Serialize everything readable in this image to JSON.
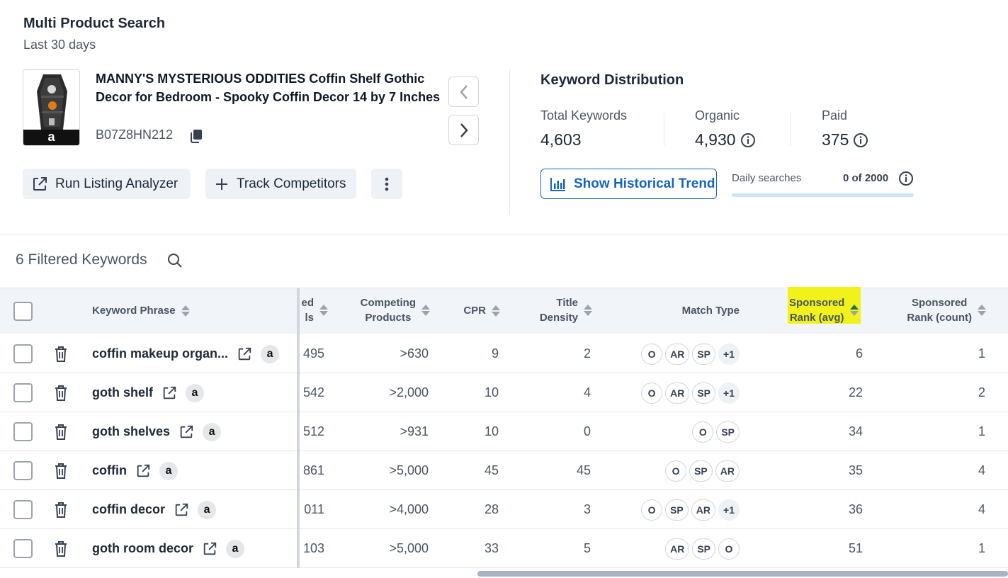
{
  "header": {
    "title": "Multi Product Search",
    "subtitle": "Last 30 days"
  },
  "product": {
    "title": "MANNY'S MYSTERIOUS ODDITIES Coffin Shelf Gothic Decor for Bedroom - Spooky Coffin Decor 14 by 7 Inches",
    "asin": "B07Z8HN212",
    "image_badge": "a"
  },
  "actions": {
    "run_listing": "Run Listing Analyzer",
    "track_competitors": "Track Competitors"
  },
  "distribution": {
    "title": "Keyword Distribution",
    "total_label": "Total Keywords",
    "total_value": "4,603",
    "organic_label": "Organic",
    "organic_value": "4,930",
    "paid_label": "Paid",
    "paid_value": "375",
    "show_trend": "Show Historical Trend",
    "daily_label": "Daily searches",
    "daily_count": "0 of 2000",
    "daily_progress": 0
  },
  "filter": {
    "label": "6 Filtered Keywords"
  },
  "table": {
    "headers": {
      "keyword": "Keyword Phrase",
      "searches_1": "ed",
      "searches_2": "ls",
      "competing_1": "Competing",
      "competing_2": "Products",
      "cpr": "CPR",
      "title_1": "Title",
      "title_2": "Density",
      "match": "Match Type",
      "sp_avg_1": "Sponsored",
      "sp_avg_2": "Rank (avg)",
      "sp_cnt_1": "Sponsored",
      "sp_cnt_2": "Rank (count)"
    },
    "rows": [
      {
        "keyword": "coffin makeup organ...",
        "searches": "495",
        "competing": ">630",
        "cpr": "9",
        "title_density": "2",
        "match": [
          "O",
          "AR",
          "SP",
          "+1"
        ],
        "sp_avg": "6",
        "sp_count": "1"
      },
      {
        "keyword": "goth shelf",
        "searches": "542",
        "competing": ">2,000",
        "cpr": "10",
        "title_density": "4",
        "match": [
          "O",
          "AR",
          "SP",
          "+1"
        ],
        "sp_avg": "22",
        "sp_count": "2"
      },
      {
        "keyword": "goth shelves",
        "searches": "512",
        "competing": ">931",
        "cpr": "10",
        "title_density": "0",
        "match": [
          "O",
          "SP"
        ],
        "sp_avg": "34",
        "sp_count": "1"
      },
      {
        "keyword": "coffin",
        "searches": "861",
        "competing": ">5,000",
        "cpr": "45",
        "title_density": "45",
        "match": [
          "O",
          "SP",
          "AR"
        ],
        "sp_avg": "35",
        "sp_count": "4"
      },
      {
        "keyword": "coffin decor",
        "searches": "011",
        "competing": ">4,000",
        "cpr": "28",
        "title_density": "3",
        "match": [
          "O",
          "SP",
          "AR",
          "+1"
        ],
        "sp_avg": "36",
        "sp_count": "4"
      },
      {
        "keyword": "goth room decor",
        "searches": "103",
        "competing": ">5,000",
        "cpr": "33",
        "title_density": "5",
        "match": [
          "AR",
          "SP",
          "O"
        ],
        "sp_avg": "51",
        "sp_count": "1"
      }
    ]
  },
  "colors": {
    "accent": "#1565c0",
    "highlight": "#f0f21a",
    "header_bg": "#f1f4f8"
  }
}
